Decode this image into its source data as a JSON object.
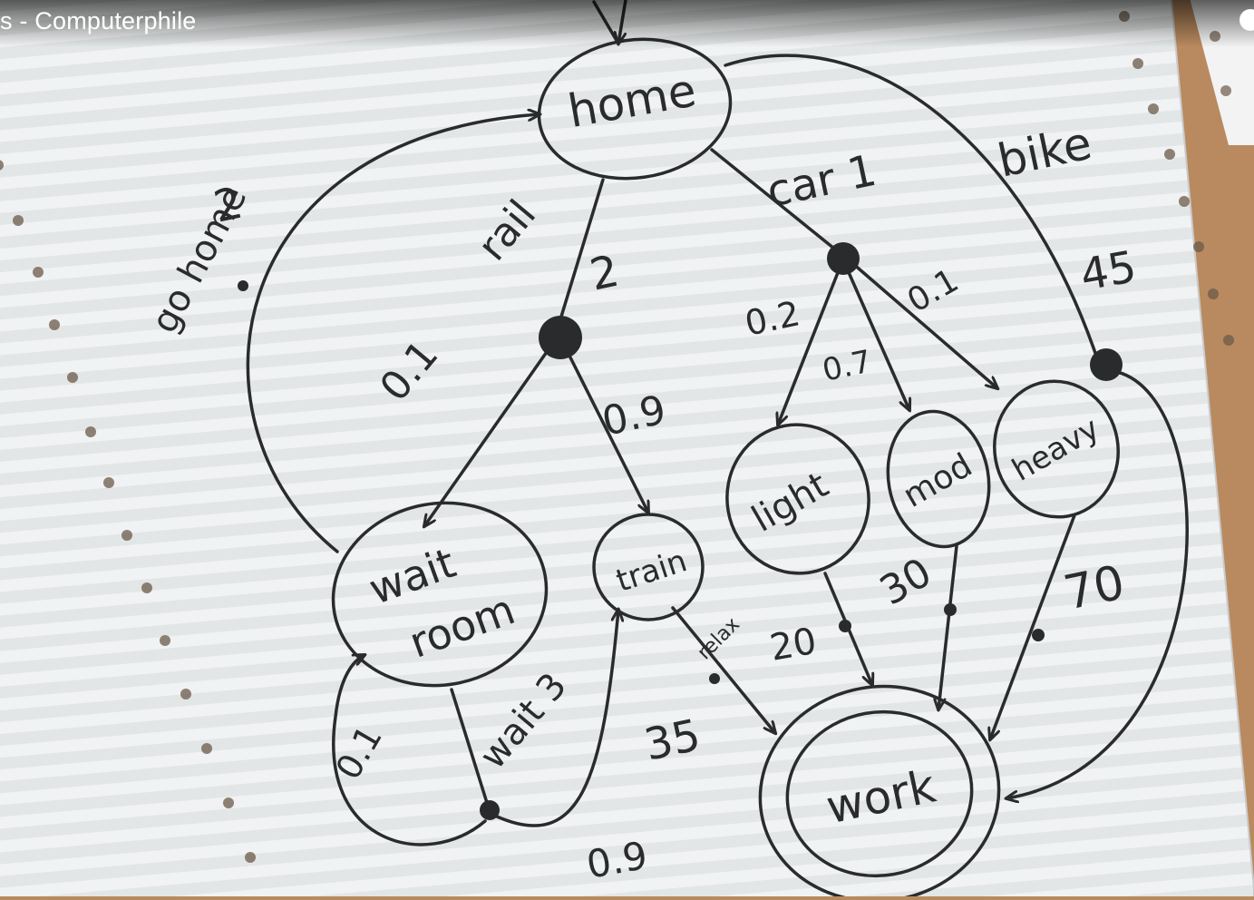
{
  "video_title": "s - Computerphile",
  "diagram": {
    "states": [
      {
        "id": "home",
        "label": "home"
      },
      {
        "id": "wait_room",
        "label_line1": "wait",
        "label_line2": "room"
      },
      {
        "id": "train",
        "label": "train"
      },
      {
        "id": "light",
        "label": "light"
      },
      {
        "id": "mod",
        "label": "mod"
      },
      {
        "id": "heavy",
        "label": "heavy"
      },
      {
        "id": "work",
        "label": "work"
      }
    ],
    "actions": {
      "gohome": "go home",
      "gohome_cost": "2",
      "rail": "rail",
      "rail_cost": "2",
      "car": "car 1",
      "bike": "bike",
      "bike_cost": "45",
      "wait": "wait 3",
      "relax": "relax"
    },
    "probabilities": {
      "rail_to_waitroom": "0.1",
      "rail_to_train": "0.9",
      "car_to_light": "0.2",
      "car_to_mod": "0.7",
      "car_to_heavy": "0.1",
      "wait_loop": "0.1",
      "wait_to_train": "0.9"
    },
    "costs": {
      "train_relax": "35",
      "light": "20",
      "mod": "30",
      "heavy": "70"
    }
  }
}
